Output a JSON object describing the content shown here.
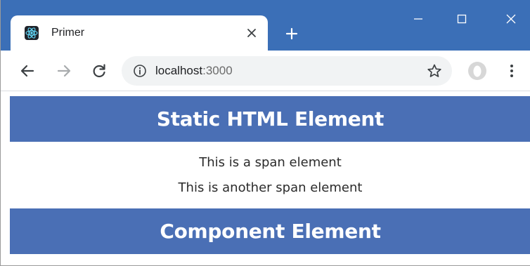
{
  "browser": {
    "tab": {
      "title": "Primer",
      "favicon": "react-logo-icon",
      "close": "close-icon"
    },
    "new_tab": "plus-icon",
    "window_controls": [
      "minimize-icon",
      "maximize-icon",
      "close-icon"
    ],
    "toolbar": {
      "back": "arrow-left-icon",
      "forward": "arrow-right-icon",
      "reload": "reload-icon",
      "site_info": "info-icon",
      "bookmark": "star-icon",
      "profile": "profile-avatar-icon",
      "menu": "kebab-menu-icon"
    },
    "address": {
      "host": "localhost",
      "port": ":3000"
    },
    "colors": {
      "titlebar": "#3b6fb7",
      "banner": "#4a6fb5"
    }
  },
  "page": {
    "static_heading": "Static HTML Element",
    "spans": [
      "This is a span element",
      "This is another span element"
    ],
    "component_heading": "Component Element"
  }
}
